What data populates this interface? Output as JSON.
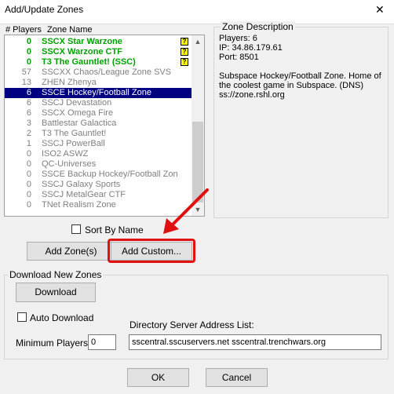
{
  "window": {
    "title": "Add/Update Zones",
    "close_glyph": "✕"
  },
  "list": {
    "col_players": "# Players",
    "col_zone": "Zone Name",
    "rows": [
      {
        "count": "0",
        "name": "SSCX Star Warzone",
        "style": "bold",
        "warn": true
      },
      {
        "count": "0",
        "name": "SSCX Warzone CTF",
        "style": "bold",
        "warn": true
      },
      {
        "count": "0",
        "name": "T3 The Gauntlet! (SSC)",
        "style": "bold",
        "warn": true
      },
      {
        "count": "57",
        "name": "SSCXX Chaos/League Zone SVS",
        "style": "gray",
        "warn": false
      },
      {
        "count": "13",
        "name": "ZHEN Zhenya",
        "style": "gray",
        "warn": false
      },
      {
        "count": "6",
        "name": "SSCE Hockey/Football Zone",
        "style": "sel",
        "warn": false
      },
      {
        "count": "6",
        "name": "SSCJ Devastation",
        "style": "gray",
        "warn": false
      },
      {
        "count": "6",
        "name": "SSCX Omega Fire",
        "style": "gray",
        "warn": false
      },
      {
        "count": "3",
        "name": "Battlestar Galactica",
        "style": "gray",
        "warn": false
      },
      {
        "count": "2",
        "name": "T3 The Gauntlet!",
        "style": "gray",
        "warn": false
      },
      {
        "count": "1",
        "name": "SSCJ PowerBall",
        "style": "gray",
        "warn": false
      },
      {
        "count": "0",
        "name": "ISO2 ASWZ",
        "style": "gray",
        "warn": false
      },
      {
        "count": "0",
        "name": "QC-Universes",
        "style": "gray",
        "warn": false
      },
      {
        "count": "0",
        "name": "SSCE Backup Hockey/Football Zon",
        "style": "gray",
        "warn": false
      },
      {
        "count": "0",
        "name": "SSCJ Galaxy Sports",
        "style": "gray",
        "warn": false
      },
      {
        "count": "0",
        "name": "SSCJ MetalGear CTF",
        "style": "gray",
        "warn": false
      },
      {
        "count": "0",
        "name": "TNet Realism Zone",
        "style": "gray",
        "warn": false
      }
    ],
    "warn_glyph": "?",
    "scroll_up_glyph": "▲",
    "scroll_down_glyph": "▼"
  },
  "sort_by_name": {
    "label": "Sort By Name",
    "checked": false
  },
  "buttons": {
    "add_zones": "Add Zone(s)",
    "add_custom": "Add Custom...",
    "ok": "OK",
    "cancel": "Cancel"
  },
  "zone_description": {
    "title": "Zone Description",
    "players": "Players: 6",
    "ip": "IP: 34.86.179.61",
    "port": "Port: 8501",
    "text": "Subspace Hockey/Football Zone.  Home of the coolest game in Subspace.  (DNS) ss://zone.rshl.org"
  },
  "download": {
    "group_title": "Download New Zones",
    "download_button": "Download",
    "auto_download_label": "Auto Download",
    "auto_download_checked": false,
    "min_players_label": "Minimum Players:",
    "min_players_value": "0",
    "dir_label": "Directory Server Address List:",
    "dir_value": "sscentral.sscuservers.net sscentral.trenchwars.org"
  },
  "colors": {
    "highlight": "#e01010",
    "selection": "#000080",
    "active_zone": "#00a000"
  }
}
